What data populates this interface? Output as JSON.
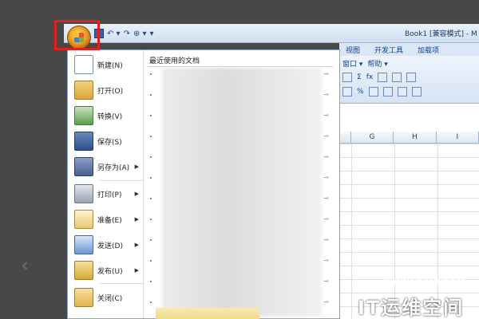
{
  "window": {
    "title": "Book1  [兼容模式] - M"
  },
  "ribbon": {
    "tabs": [
      "视图",
      "开发工具",
      "加载项"
    ],
    "groups_row1": [
      "窗口 ▾",
      "帮助 ▾"
    ],
    "fx_label": "fx",
    "sum_label": "Σ",
    "percent_label": "%"
  },
  "sheet": {
    "columns": [
      "G",
      "H",
      "I"
    ]
  },
  "menu": {
    "items": [
      {
        "label": "新建(N)",
        "icon": "new-document-icon",
        "has_arrow": false
      },
      {
        "label": "打开(O)",
        "icon": "open-folder-icon",
        "has_arrow": false
      },
      {
        "label": "转换(V)",
        "icon": "convert-icon",
        "has_arrow": false
      },
      {
        "label": "保存(S)",
        "icon": "save-disk-icon",
        "has_arrow": false
      },
      {
        "label": "另存为(A)",
        "icon": "save-as-icon",
        "has_arrow": true
      },
      {
        "label": "打印(P)",
        "icon": "printer-icon",
        "has_arrow": true
      },
      {
        "label": "准备(E)",
        "icon": "prepare-icon",
        "has_arrow": true
      },
      {
        "label": "发送(D)",
        "icon": "send-icon",
        "has_arrow": true
      },
      {
        "label": "发布(U)",
        "icon": "publish-icon",
        "has_arrow": true
      },
      {
        "label": "关闭(C)",
        "icon": "close-folder-icon",
        "has_arrow": false
      }
    ],
    "recent_title": "最近使用的文档"
  },
  "watermark": {
    "url": "WWW.94IP.COM",
    "name": "IT运维空间"
  }
}
